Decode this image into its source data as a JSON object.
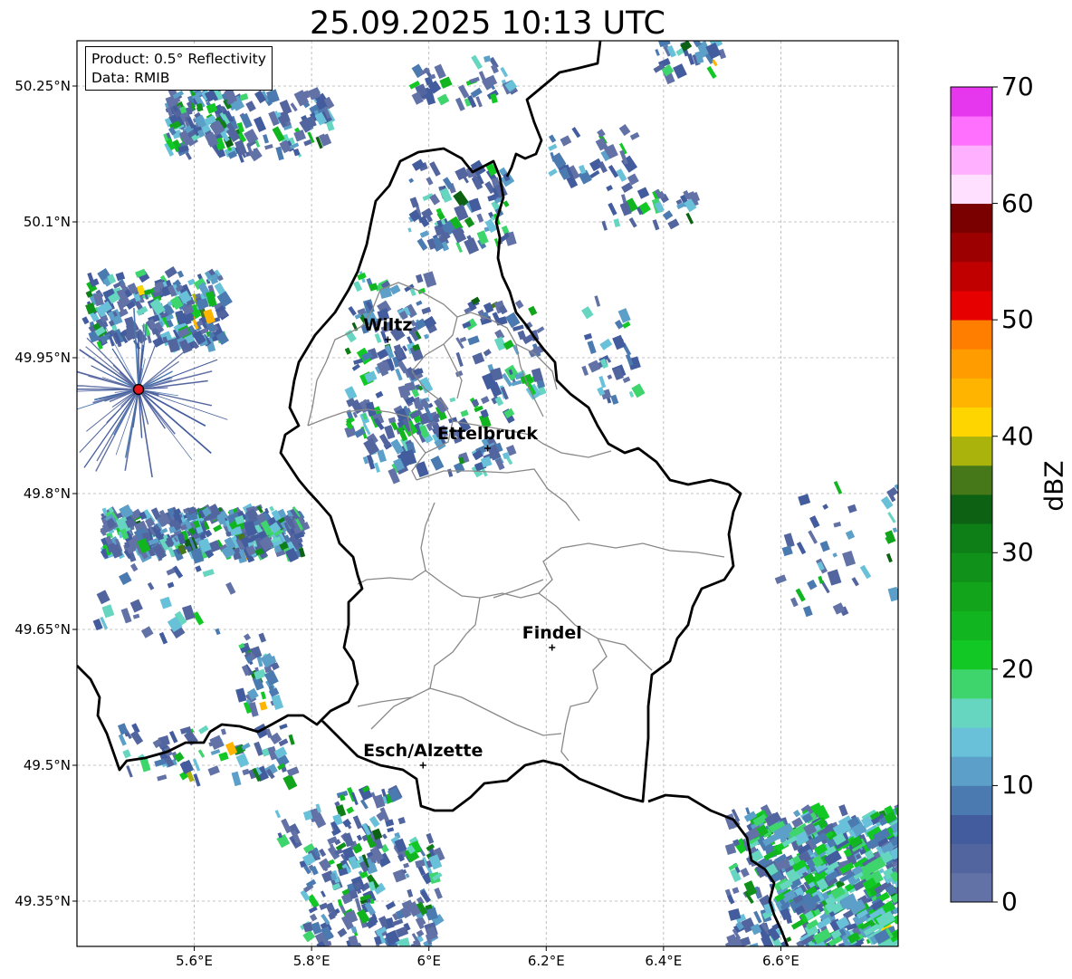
{
  "title": "25.09.2025 10:13 UTC",
  "info": {
    "product": "Product: 0.5° Reflectivity",
    "data": "Data: RMIB"
  },
  "lat_labels": [
    "50.25°N",
    "50.1°N",
    "49.95°N",
    "49.8°N",
    "49.65°N",
    "49.5°N",
    "49.35°N"
  ],
  "lon_labels": [
    "5.6°E",
    "5.8°E",
    "6°E",
    "6.2°E",
    "6.4°E",
    "6.6°E"
  ],
  "extent": {
    "lon": [
      5.4,
      6.8
    ],
    "lat": [
      49.3,
      50.3
    ]
  },
  "cities": [
    {
      "name": "Wiltz",
      "lon": 5.93,
      "lat": 49.97
    },
    {
      "name": "Ettelbruck",
      "lon": 6.1,
      "lat": 49.85
    },
    {
      "name": "Findel",
      "lon": 6.21,
      "lat": 49.63
    },
    {
      "name": "Esch/Alzette",
      "lon": 5.99,
      "lat": 49.5
    }
  ],
  "radar_site": {
    "lon": 5.505,
    "lat": 49.915,
    "color": "#e8141e"
  },
  "colorbar": {
    "label": "dBZ",
    "ticks": [
      "0",
      "10",
      "20",
      "30",
      "40",
      "50",
      "60",
      "70"
    ],
    "range": [
      0,
      70
    ],
    "colors": [
      "#6272a6",
      "#53659e",
      "#435c9e",
      "#4a7ab0",
      "#5c9fc8",
      "#68c1d9",
      "#66d6c0",
      "#3fd56d",
      "#12c825",
      "#11b51f",
      "#12a41a",
      "#0f911a",
      "#0d7f16",
      "#0c6212",
      "#467718",
      "#aab20c",
      "#ffd500",
      "#ffb400",
      "#ff9c00",
      "#ff7e00",
      "#e60000",
      "#c00000",
      "#9c0000",
      "#7a0000",
      "#ffe0ff",
      "#ffb0ff",
      "#ff70ff",
      "#e737ee"
    ]
  }
}
